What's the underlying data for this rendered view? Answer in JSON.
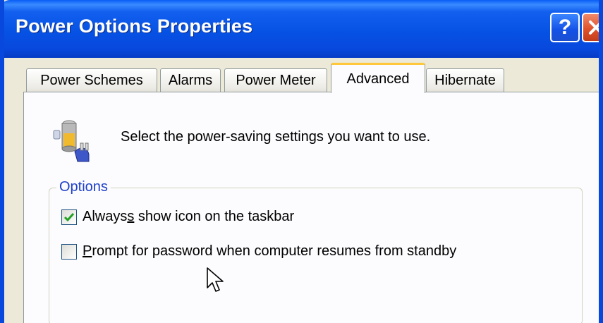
{
  "window": {
    "title": "Power Options Properties",
    "help_glyph": "?",
    "close_icon": "close-icon"
  },
  "tabs": [
    {
      "label": "Power Schemes",
      "active": false
    },
    {
      "label": "Alarms",
      "active": false
    },
    {
      "label": "Power Meter",
      "active": false
    },
    {
      "label": "Advanced",
      "active": true
    },
    {
      "label": "Hibernate",
      "active": false
    }
  ],
  "advanced": {
    "intro_icon": "power-battery-plug-icon",
    "intro_text": "Select the power-saving settings you want to use.",
    "options_group": {
      "label": "Options",
      "items": [
        {
          "pre": "Always",
          "hotkey": "s",
          "post": " show icon on the taskbar",
          "checked": true
        },
        {
          "pre": "",
          "hotkey": "P",
          "post": "rompt for password when computer resumes from standby",
          "checked": false
        }
      ]
    }
  },
  "colors": {
    "titlebar": "#0848dd",
    "active_tab_accent": "#ffc83c",
    "group_label": "#1e40c8",
    "checkmark": "#21a121"
  }
}
